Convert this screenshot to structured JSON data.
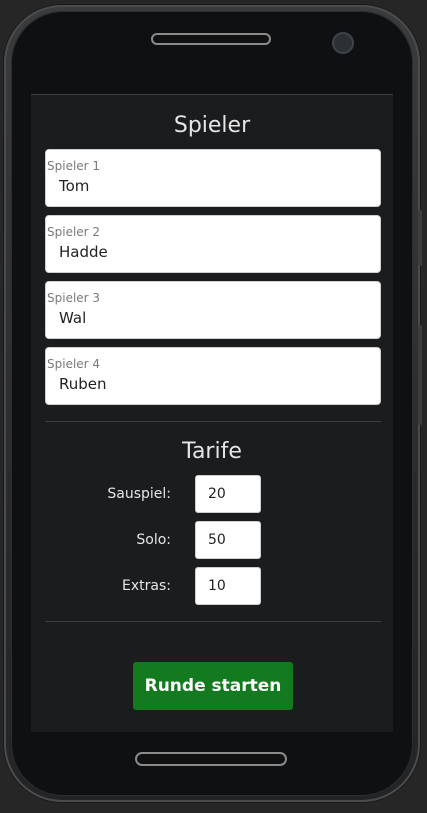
{
  "players": {
    "title": "Spieler",
    "fields": [
      {
        "label": "Spieler 1",
        "value": "Tom"
      },
      {
        "label": "Spieler 2",
        "value": "Hadde"
      },
      {
        "label": "Spieler 3",
        "value": "Wal"
      },
      {
        "label": "Spieler 4",
        "value": "Ruben"
      }
    ]
  },
  "tariffs": {
    "title": "Tarife",
    "rows": [
      {
        "label": "Sauspiel:",
        "value": "20"
      },
      {
        "label": "Solo:",
        "value": "50"
      },
      {
        "label": "Extras:",
        "value": "10"
      }
    ]
  },
  "actions": {
    "start_label": "Runde starten",
    "start_color": "#137a1f"
  },
  "colors": {
    "background": "#1a1c1e",
    "text": "#e6e6e6"
  }
}
